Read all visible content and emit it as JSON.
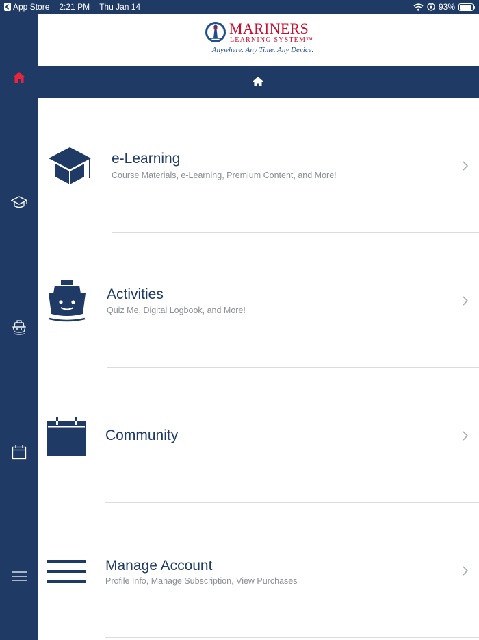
{
  "status_bar": {
    "back_app": "App Store",
    "time": "2:21 PM",
    "date": "Thu Jan 14",
    "battery": "93%",
    "battery_level": 0.93,
    "icons": [
      "back-chevron-icon",
      "wifi-icon",
      "orientation-lock-icon",
      "battery-icon"
    ]
  },
  "logo": {
    "title": "MARINERS",
    "subtitle": "LEARNING SYSTEM™",
    "tagline": "Anywhere. Any Time. Any Device."
  },
  "sidebar": {
    "items": [
      {
        "icon": "home-icon",
        "active": true
      },
      {
        "icon": "graduation-cap-icon",
        "active": false
      },
      {
        "icon": "ship-icon",
        "active": false
      },
      {
        "icon": "calendar-icon",
        "active": false
      },
      {
        "icon": "menu-icon",
        "active": false
      }
    ]
  },
  "navbar": {
    "icon": "home-icon"
  },
  "menu": {
    "items": [
      {
        "icon": "graduation-cap-icon",
        "title": "e-Learning",
        "subtitle": "Course Materials, e-Learning, Premium Content, and More!"
      },
      {
        "icon": "ship-icon",
        "title": "Activities",
        "subtitle": "Quiz Me, Digital Logbook, and More!"
      },
      {
        "icon": "calendar-icon",
        "title": "Community",
        "subtitle": ""
      },
      {
        "icon": "menu-icon",
        "title": "Manage Account",
        "subtitle": "Profile Info, Manage Subscription, View Purchases"
      }
    ]
  },
  "colors": {
    "navy": "#1f3a64",
    "brand_red": "#c8102e",
    "tagline_blue": "#1f4e8c",
    "subtitle_gray": "#8a8f96",
    "divider": "#dcdcdc"
  }
}
